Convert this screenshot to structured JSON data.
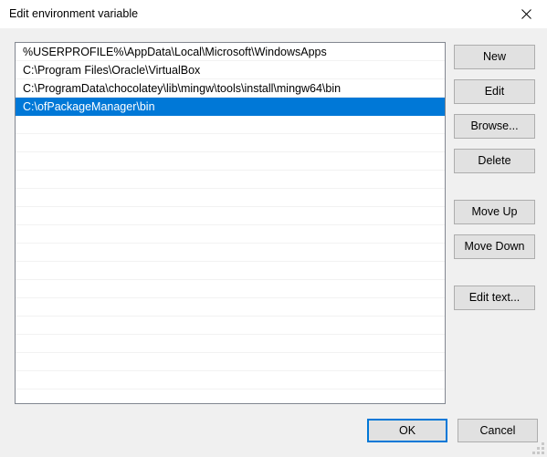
{
  "window": {
    "title": "Edit environment variable",
    "close_icon": "close-icon"
  },
  "list": {
    "entries": [
      "%USERPROFILE%\\AppData\\Local\\Microsoft\\WindowsApps",
      "C:\\Program Files\\Oracle\\VirtualBox",
      "C:\\ProgramData\\chocolatey\\lib\\mingw\\tools\\install\\mingw64\\bin",
      "C:\\ofPackageManager\\bin"
    ],
    "selected_index": 3,
    "empty_row_count": 15
  },
  "side_buttons": {
    "new": "New",
    "edit": "Edit",
    "browse": "Browse...",
    "delete": "Delete",
    "move_up": "Move Up",
    "move_down": "Move Down",
    "edit_text": "Edit text..."
  },
  "bottom_buttons": {
    "ok": "OK",
    "cancel": "Cancel"
  },
  "colors": {
    "selection": "#0078d7",
    "dialog_background": "#f0f0f0",
    "button_face": "#e1e1e1",
    "button_border": "#adadad",
    "listbox_border": "#828790"
  }
}
